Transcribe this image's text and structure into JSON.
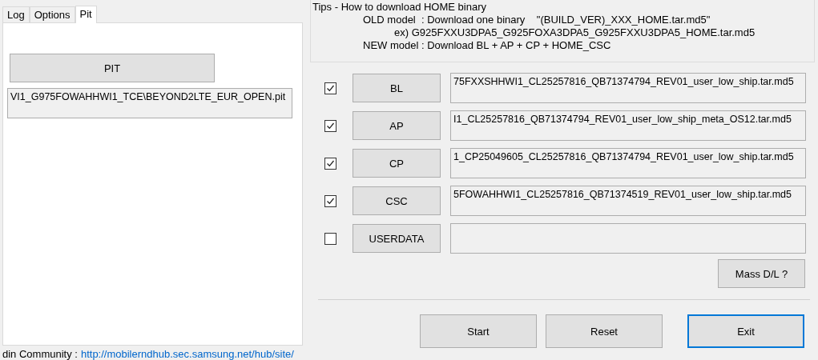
{
  "tabs": [
    {
      "label": "Log",
      "selected": false
    },
    {
      "label": "Options",
      "selected": false
    },
    {
      "label": "Pit",
      "selected": true
    }
  ],
  "pit": {
    "button": "PIT",
    "file": "VI1_G975FOWAHHWI1_TCE\\BEYOND2LTE_EUR_OPEN.pit"
  },
  "tips": {
    "title": "Tips - How to download HOME binary",
    "lines": [
      {
        "kind": "main",
        "text": "OLD model  : Download one binary    \"(BUILD_VER)_XXX_HOME.tar.md5\""
      },
      {
        "kind": "example",
        "text": "ex) G925FXXU3DPA5_G925FOXA3DPA5_G925FXXU3DPA5_HOME.tar.md5"
      },
      {
        "kind": "main",
        "text": "NEW model : Download BL + AP + CP + HOME_CSC"
      }
    ]
  },
  "files": [
    {
      "label": "BL",
      "checked": true,
      "path": "75FXXSHHWI1_CL25257816_QB71374794_REV01_user_low_ship.tar.md5"
    },
    {
      "label": "AP",
      "checked": true,
      "path": "I1_CL25257816_QB71374794_REV01_user_low_ship_meta_OS12.tar.md5"
    },
    {
      "label": "CP",
      "checked": true,
      "path": "1_CP25049605_CL25257816_QB71374794_REV01_user_low_ship.tar.md5"
    },
    {
      "label": "CSC",
      "checked": true,
      "path": "5FOWAHHWI1_CL25257816_QB71374519_REV01_user_low_ship.tar.md5"
    },
    {
      "label": "USERDATA",
      "checked": false
    }
  ],
  "mass_button": "Mass D/L ?",
  "actions": [
    {
      "label": "Start",
      "focused": false
    },
    {
      "label": "Reset",
      "focused": false
    },
    {
      "label": "Exit",
      "focused": true
    }
  ],
  "footer": {
    "label": "din Community :",
    "link": "http://mobilerndhub.sec.samsung.net/hub/site/"
  }
}
